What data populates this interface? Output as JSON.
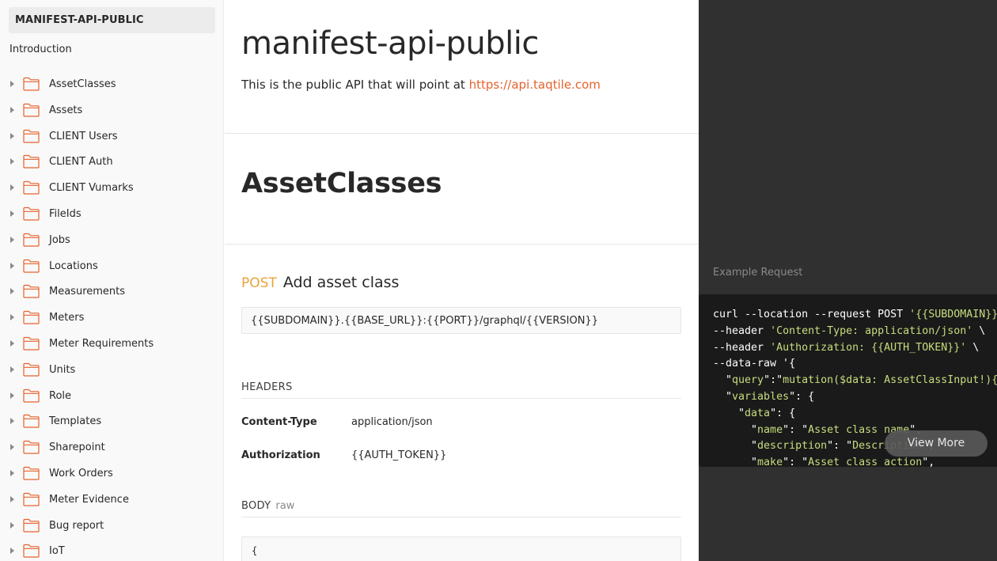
{
  "sidebar": {
    "collection_title": "MANIFEST-API-PUBLIC",
    "intro_label": "Introduction",
    "folders": [
      {
        "label": "AssetClasses"
      },
      {
        "label": "Assets"
      },
      {
        "label": "CLIENT Users"
      },
      {
        "label": "CLIENT Auth"
      },
      {
        "label": "CLIENT Vumarks"
      },
      {
        "label": "FileIds"
      },
      {
        "label": "Jobs"
      },
      {
        "label": "Locations"
      },
      {
        "label": "Measurements"
      },
      {
        "label": "Meters"
      },
      {
        "label": "Meter Requirements"
      },
      {
        "label": "Units"
      },
      {
        "label": "Role"
      },
      {
        "label": "Templates"
      },
      {
        "label": "Sharepoint"
      },
      {
        "label": "Work Orders"
      },
      {
        "label": "Meter Evidence"
      },
      {
        "label": "Bug report"
      },
      {
        "label": "IoT"
      }
    ],
    "folder_icon": "folder-icon",
    "caret_icon": "caret-right-icon"
  },
  "main": {
    "title": "manifest-api-public",
    "description_prefix": "This is the public API that will point at ",
    "description_link": "https://api.taqtile.com",
    "section_title": "AssetClasses",
    "request": {
      "method": "POST",
      "name": "Add asset class",
      "url": "{{SUBDOMAIN}}.{{BASE_URL}}:{{PORT}}/graphql/{{VERSION}}",
      "headers_label": "HEADERS",
      "headers": [
        {
          "key": "Content-Type",
          "value": "application/json"
        },
        {
          "key": "Authorization",
          "value": "{{AUTH_TOKEN}}"
        }
      ],
      "body_label": "BODY",
      "body_mode": "raw",
      "body_preview": "{"
    }
  },
  "example": {
    "label": "Example Request",
    "code_lines": [
      [
        {
          "t": "curl --location --request POST "
        },
        {
          "t": "'{{SUBDOMAIN}}.{{BASE_URL}}",
          "s": true
        }
      ],
      [
        {
          "t": "--header "
        },
        {
          "t": "'Content-Type: application/json'",
          "s": true
        },
        {
          "t": " \\"
        }
      ],
      [
        {
          "t": "--header "
        },
        {
          "t": "'Authorization: {{AUTH_TOKEN}}'",
          "s": true
        },
        {
          "t": " \\"
        }
      ],
      [
        {
          "t": "--data-raw '{"
        }
      ],
      [
        {
          "t": "  \""
        },
        {
          "t": "query",
          "s": true
        },
        {
          "t": "\":\""
        },
        {
          "t": "mutation($data: AssetClassInput!){cr",
          "s": true
        }
      ],
      [
        {
          "t": "  \""
        },
        {
          "t": "variables",
          "s": true
        },
        {
          "t": "\": {"
        }
      ],
      [
        {
          "t": "    \""
        },
        {
          "t": "data",
          "s": true
        },
        {
          "t": "\": {"
        }
      ],
      [
        {
          "t": "      \""
        },
        {
          "t": "name",
          "s": true
        },
        {
          "t": "\": \""
        },
        {
          "t": "Asset class name",
          "s": true
        },
        {
          "t": "\","
        }
      ],
      [
        {
          "t": "      \""
        },
        {
          "t": "description",
          "s": true
        },
        {
          "t": "\": \""
        },
        {
          "t": "Description",
          "s": true
        },
        {
          "t": "\","
        }
      ],
      [
        {
          "t": "      \""
        },
        {
          "t": "make",
          "s": true
        },
        {
          "t": "\": \""
        },
        {
          "t": "Asset class action",
          "s": true
        },
        {
          "t": "\","
        }
      ]
    ],
    "view_more_label": "View More"
  },
  "colors": {
    "accent_orange": "#e6622d",
    "method_post": "#e8a33a",
    "code_string": "#c6dd7f",
    "dark_panel": "#303030",
    "code_bg": "#1a1a1a"
  }
}
